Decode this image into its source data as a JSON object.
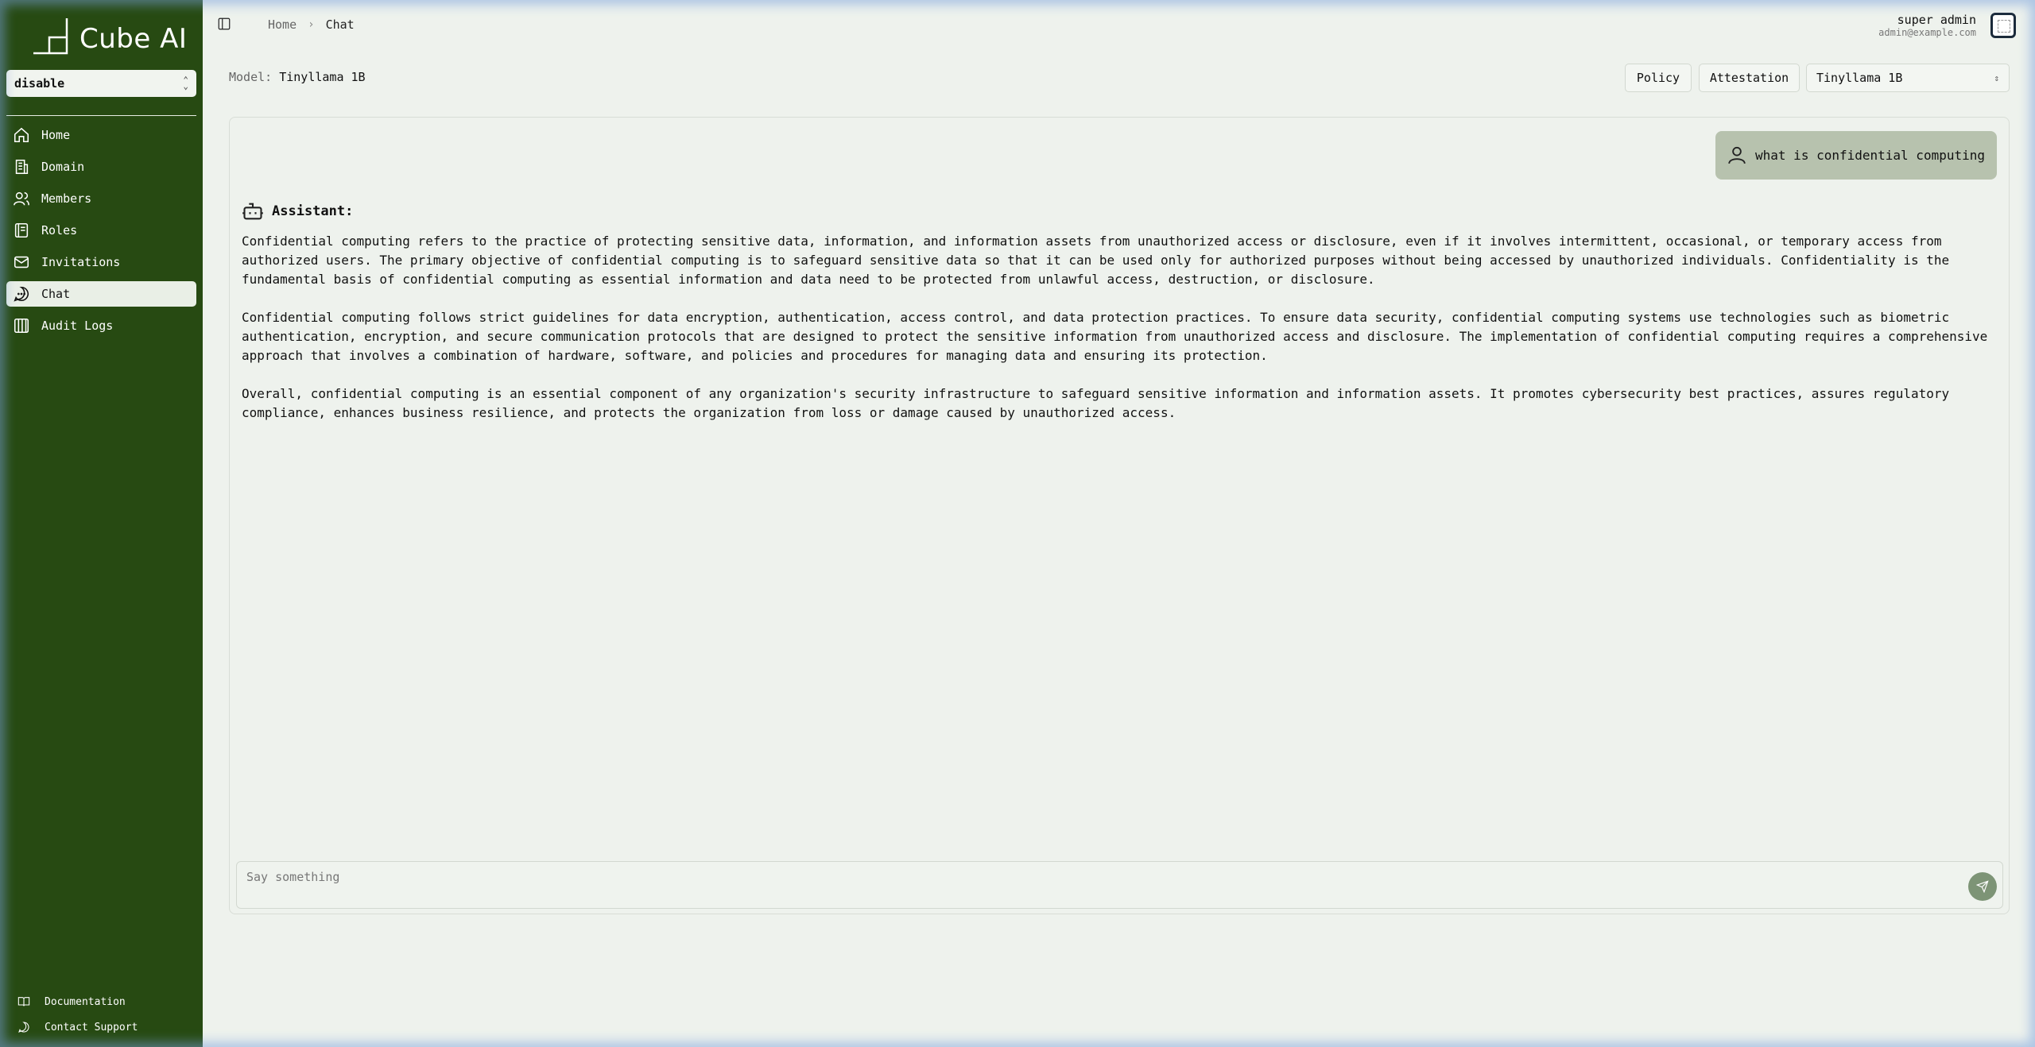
{
  "app": {
    "name": "Cube AI"
  },
  "sidebar": {
    "domain_select": "disable",
    "items": [
      {
        "label": "Home",
        "icon": "home-icon"
      },
      {
        "label": "Domain",
        "icon": "building-icon"
      },
      {
        "label": "Members",
        "icon": "users-icon"
      },
      {
        "label": "Roles",
        "icon": "book-icon"
      },
      {
        "label": "Invitations",
        "icon": "mail-icon"
      },
      {
        "label": "Chat",
        "icon": "chat-icon",
        "active": true
      },
      {
        "label": "Audit Logs",
        "icon": "columns-icon"
      }
    ],
    "footer": [
      {
        "label": "Documentation",
        "icon": "book-open-icon"
      },
      {
        "label": "Contact Support",
        "icon": "message-circle-icon"
      }
    ],
    "background": "#274a12"
  },
  "header": {
    "breadcrumb": {
      "home": "Home",
      "current": "Chat"
    },
    "user": {
      "name": "super admin",
      "email": "admin@example.com"
    }
  },
  "toolbar": {
    "model_label": "Model:",
    "model_value": "Tinyllama 1B",
    "policy_label": "Policy",
    "attestation_label": "Attestation",
    "model_select": "Tinyllama 1B"
  },
  "chat": {
    "user_message": "what is confidential computing",
    "assistant_label": "Assistant:",
    "assistant_paragraphs": [
      "Confidential computing refers to the practice of protecting sensitive data, information, and information assets from unauthorized access or disclosure, even if it involves intermittent, occasional, or temporary access from authorized users. The primary objective of confidential computing is to safeguard sensitive data so that it can be used only for authorized purposes without being accessed by unauthorized individuals. Confidentiality is the fundamental basis of confidential computing as essential information and data need to be protected from unlawful access, destruction, or disclosure.",
      "Confidential computing follows strict guidelines for data encryption, authentication, access control, and data protection practices. To ensure data security, confidential computing systems use technologies such as biometric authentication, encryption, and secure communication protocols that are designed to protect the sensitive information from unauthorized access and disclosure. The implementation of confidential computing requires a comprehensive approach that involves a combination of hardware, software, and policies and procedures for managing data and ensuring its protection.",
      "Overall, confidential computing is an essential component of any organization's security infrastructure to safeguard sensitive information and information assets. It promotes cybersecurity best practices, assures regulatory compliance, enhances business resilience, and protects the organization from loss or damage caused by unauthorized access."
    ],
    "input_placeholder": "Say something",
    "send_color": "#7d9476"
  }
}
